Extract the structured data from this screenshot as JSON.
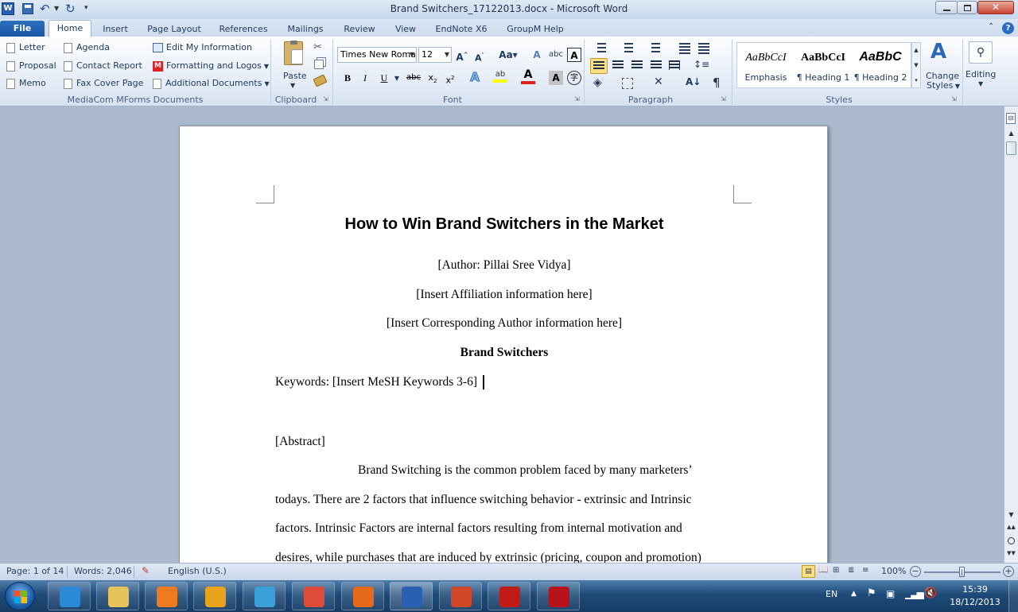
{
  "titlebar": {
    "title": "Brand Switchers_17122013.docx - Microsoft Word"
  },
  "tabs": [
    {
      "label": "File"
    },
    {
      "label": "Home"
    },
    {
      "label": "Insert"
    },
    {
      "label": "Page Layout"
    },
    {
      "label": "References"
    },
    {
      "label": "Mailings"
    },
    {
      "label": "Review"
    },
    {
      "label": "View"
    },
    {
      "label": "EndNote X6"
    },
    {
      "label": "GroupM Help"
    }
  ],
  "mforms": {
    "col1": [
      "Letter",
      "Proposal",
      "Memo"
    ],
    "col2": [
      "Agenda",
      "Contact Report",
      "Fax Cover Page"
    ],
    "col3": [
      "Edit My Information",
      "Formatting and Logos",
      "Additional Documents"
    ],
    "group_label": "MediaCom MForms Documents"
  },
  "clipboard": {
    "paste_label": "Paste",
    "group_label": "Clipboard"
  },
  "font": {
    "name": "Times New Roma",
    "size": "12",
    "group_label": "Font"
  },
  "paragraph": {
    "group_label": "Paragraph"
  },
  "styles": {
    "items": [
      {
        "preview": "AaBbCcI",
        "name": "Emphasis"
      },
      {
        "preview": "AaBbCcI",
        "name": "¶ Heading 1"
      },
      {
        "preview": "AaBbC",
        "name": "¶ Heading 2"
      }
    ],
    "change_label_1": "Change",
    "change_label_2": "Styles",
    "group_label": "Styles"
  },
  "editing": {
    "label": "Editing"
  },
  "document": {
    "title": "How to Win Brand Switchers in the Market",
    "author": "[Author: Pillai  Sree Vidya]",
    "affiliation": "[Insert Affiliation information here]",
    "corresponding": "[Insert Corresponding Author information here]",
    "subtitle": "Brand Switchers",
    "keywords": "Keywords:  [Insert MeSH Keywords 3-6]",
    "abstract": "[Abstract]",
    "para_line1": "Brand Switching is the common problem  faced by many marketers’",
    "para_line2": "todays. There are 2 factors that influence switching behavior - extrinsic and Intrinsic",
    "para_line3": "factors. Intrinsic Factors are internal factors resulting  from internal motivation and",
    "para_line4": "desires, while purchases that are induced by extrinsic (pricing,  coupon and promotion)"
  },
  "status": {
    "page": "Page: 1 of 14",
    "words": "Words: 2,046",
    "language": "English (U.S.)",
    "zoom": "100%",
    "zoom_level_fraction": 0.5
  },
  "taskbar": {
    "lang": "EN",
    "time": "15:39",
    "date": "18/12/2013",
    "apps": [
      {
        "name": "internet-explorer",
        "color": "#2a8ad8"
      },
      {
        "name": "file-explorer",
        "color": "#e8c25a"
      },
      {
        "name": "media-player",
        "color": "#f07a20"
      },
      {
        "name": "outlook",
        "color": "#e8a21c"
      },
      {
        "name": "communicator",
        "color": "#3ca0d8"
      },
      {
        "name": "chrome",
        "color": "#dd4b39"
      },
      {
        "name": "firefox",
        "color": "#e66a1c"
      },
      {
        "name": "word",
        "color": "#2b5fb4"
      },
      {
        "name": "powerpoint",
        "color": "#d24726"
      },
      {
        "name": "acrobat",
        "color": "#c11b17"
      },
      {
        "name": "endnote",
        "color": "#b8121a"
      }
    ]
  }
}
